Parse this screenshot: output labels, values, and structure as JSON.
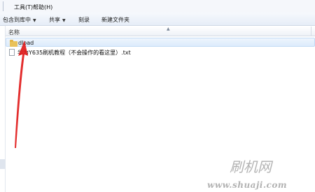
{
  "menu": {
    "tools": "工具(T)",
    "help": "帮助(H)"
  },
  "toolbar": {
    "include_in_library": "包含到库中",
    "share": "共享",
    "burn": "刻录",
    "new_folder": "新建文件夹"
  },
  "columns": {
    "name": "名称"
  },
  "files": [
    {
      "name": "dload",
      "type": "folder",
      "selected": true
    },
    {
      "name": "华为Y635刷机教程（不会操作的看这里）.txt",
      "type": "txt",
      "selected": false
    }
  ],
  "watermark": {
    "logo": "刷机网",
    "url": "www.shuaji.com"
  },
  "colors": {
    "accent_arrow": "#e11b1b",
    "selection": "#dcebfc",
    "toolbar": "#e6edf7"
  }
}
